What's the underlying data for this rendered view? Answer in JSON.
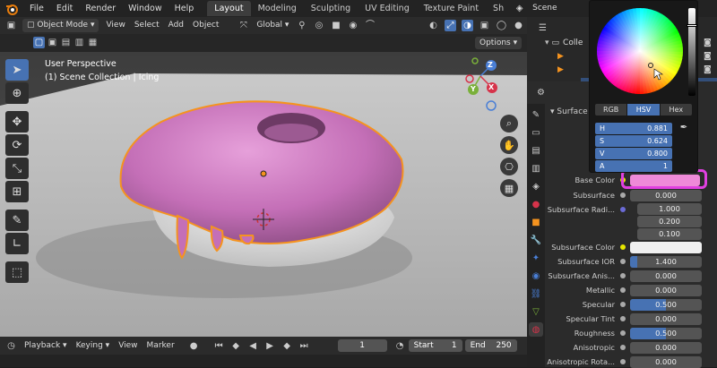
{
  "topbar": {
    "menus": [
      "File",
      "Edit",
      "Render",
      "Window",
      "Help"
    ],
    "workspaces": [
      "Layout",
      "Modeling",
      "Sculpting",
      "UV Editing",
      "Texture Paint",
      "Sh"
    ],
    "active_workspace": "Layout",
    "scene_label": "Scene"
  },
  "header": {
    "mode": "Object Mode",
    "menus": [
      "View",
      "Select",
      "Add",
      "Object"
    ],
    "orientation": "Global",
    "options_label": "Options"
  },
  "viewport": {
    "perspective": "User Perspective",
    "collection_info": "(1) Scene Collection | Icing",
    "gizmo_axes": [
      "X",
      "Y",
      "Z"
    ]
  },
  "outliner": {
    "items": [
      "Colle"
    ]
  },
  "properties": {
    "section": "Surface",
    "base_color_label": "Base Color",
    "base_color": "#ee8ad8",
    "rows": [
      {
        "label": "Subsurface",
        "value": "0.000",
        "fill": 0
      },
      {
        "label": "Subsurface Radi...",
        "values": [
          "1.000",
          "0.200",
          "0.100"
        ]
      },
      {
        "label": "Subsurface Color",
        "color": "#f0f0f0"
      },
      {
        "label": "Subsurface IOR",
        "value": "1.400",
        "fill": 0.1
      },
      {
        "label": "Subsurface Anis...",
        "value": "0.000",
        "fill": 0
      },
      {
        "label": "Metallic",
        "value": "0.000",
        "fill": 0
      },
      {
        "label": "Specular",
        "value": "0.500",
        "fill": 0.5
      },
      {
        "label": "Specular Tint",
        "value": "0.000",
        "fill": 0
      },
      {
        "label": "Roughness",
        "value": "0.500",
        "fill": 0.5
      },
      {
        "label": "Anisotropic",
        "value": "0.000",
        "fill": 0
      },
      {
        "label": "Anisotropic Rota...",
        "value": "0.000",
        "fill": 0
      }
    ]
  },
  "color_picker": {
    "tabs": [
      "RGB",
      "HSV",
      "Hex"
    ],
    "active_tab": "HSV",
    "fields": [
      {
        "label": "H",
        "value": "0.881"
      },
      {
        "label": "S",
        "value": "0.624"
      },
      {
        "label": "V",
        "value": "0.800"
      },
      {
        "label": "A",
        "value": "1"
      }
    ]
  },
  "timeline": {
    "menus": [
      "Playback",
      "Keying",
      "View",
      "Marker"
    ],
    "current_frame": "1",
    "start_label": "Start",
    "start": "1",
    "end_label": "End",
    "end": "250"
  },
  "colors": {
    "accent": "#4772b3",
    "selection_outline": "#f5931f",
    "icing": "#c46fb7",
    "highlight_ring": "#e040e0"
  }
}
